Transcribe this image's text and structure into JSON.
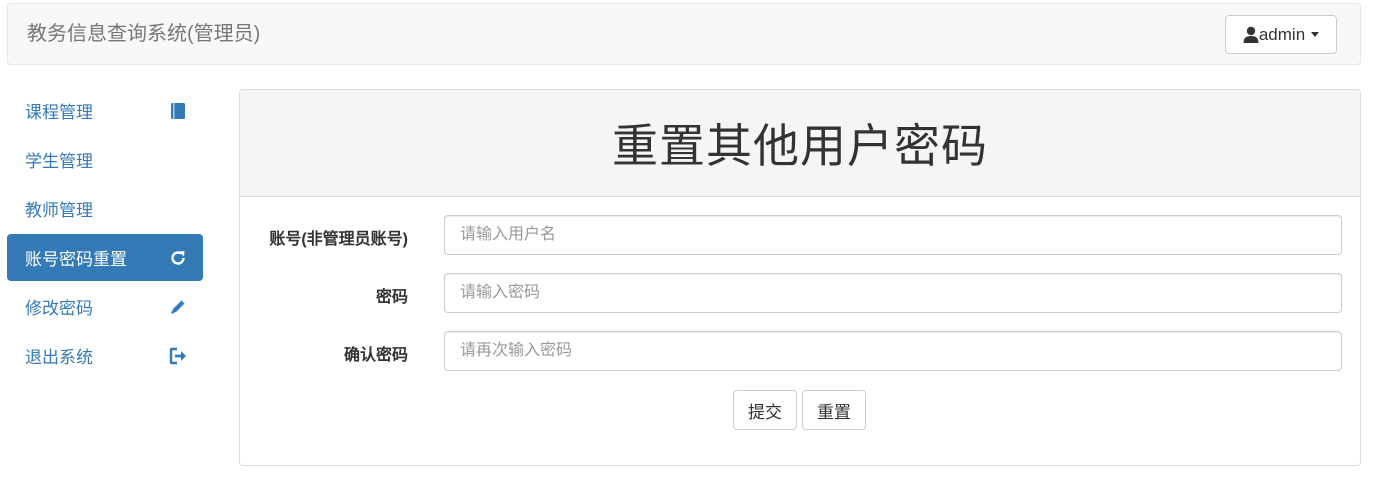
{
  "navbar": {
    "brand": "教务信息查询系统(管理员)",
    "user": {
      "label": "admin",
      "icon": "user-icon"
    }
  },
  "sidebar": {
    "items": [
      {
        "label": "课程管理",
        "icon": "book-icon",
        "active": false
      },
      {
        "label": "学生管理",
        "icon": "",
        "active": false
      },
      {
        "label": "教师管理",
        "icon": "",
        "active": false
      },
      {
        "label": "账号密码重置",
        "icon": "refresh-icon",
        "active": true
      },
      {
        "label": "修改密码",
        "icon": "pencil-icon",
        "active": false
      },
      {
        "label": "退出系统",
        "icon": "logout-icon",
        "active": false
      }
    ],
    "accent_color": "#337ab7"
  },
  "panel": {
    "title": "重置其他用户密码",
    "fields": [
      {
        "label": "账号(非管理员账号)",
        "placeholder": "请输入用户名",
        "value": ""
      },
      {
        "label": "密码",
        "placeholder": "请输入密码",
        "value": ""
      },
      {
        "label": "确认密码",
        "placeholder": "请再次输入密码",
        "value": ""
      }
    ],
    "buttons": {
      "submit": "提交",
      "reset": "重置"
    }
  }
}
